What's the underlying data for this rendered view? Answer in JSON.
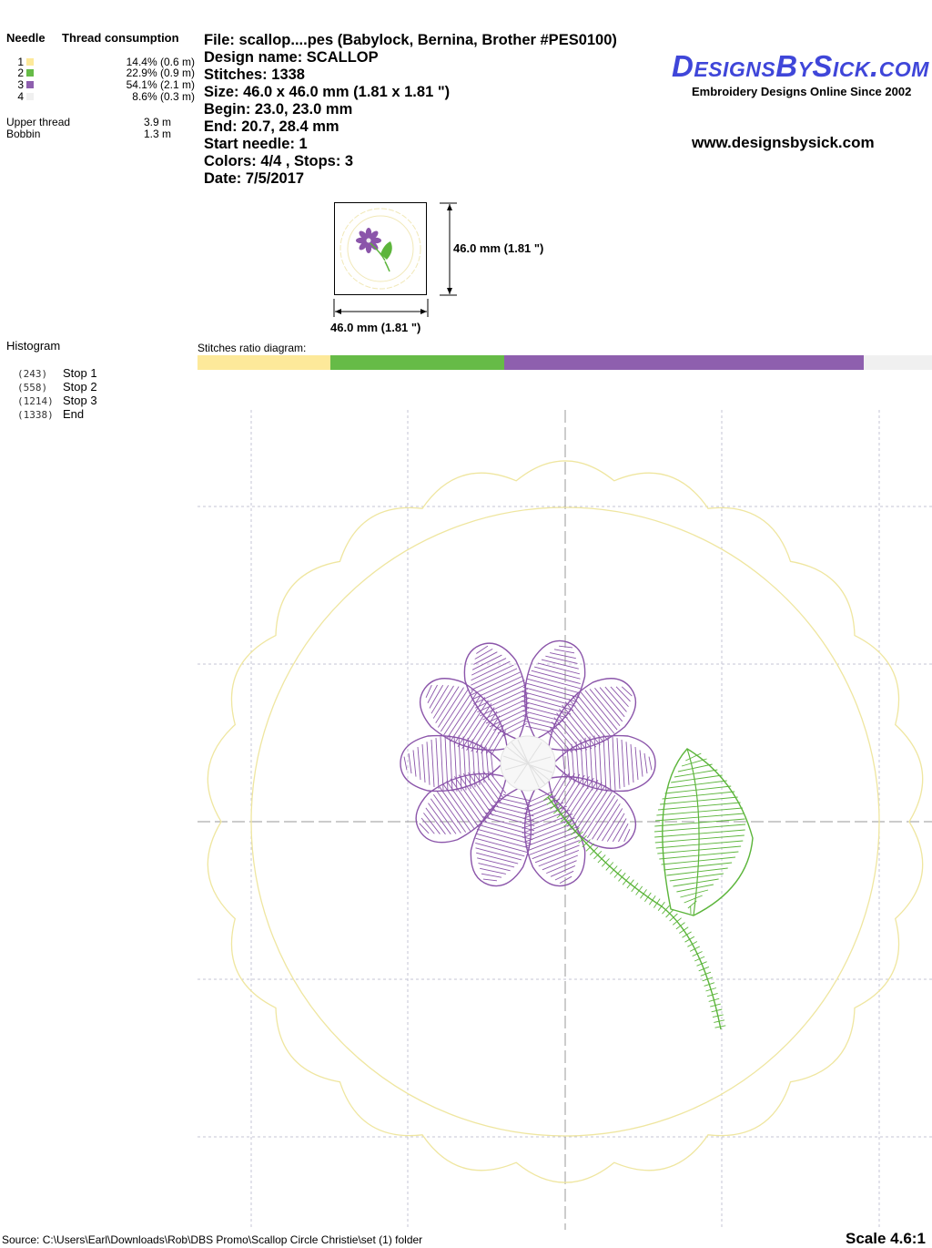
{
  "thread_table": {
    "needle_header": "Needle",
    "consumption_header": "Thread consumption",
    "needles": [
      {
        "num": "1",
        "color": "#fde99a",
        "pct": "14.4% (0.6 m)"
      },
      {
        "num": "2",
        "color": "#66bb47",
        "pct": "22.9% (0.9 m)"
      },
      {
        "num": "3",
        "color": "#8e5fae",
        "pct": "54.1% (2.1 m)"
      },
      {
        "num": "4",
        "color": "#f0f0f0",
        "pct": "8.6% (0.3 m)"
      }
    ],
    "upper_thread_label": "Upper thread",
    "upper_thread_value": "3.9 m",
    "bobbin_label": "Bobbin",
    "bobbin_value": "1.3 m"
  },
  "info": {
    "file": "File: scallop....pes  (Babylock, Bernina, Brother #PES0100)",
    "design_name": "Design name: SCALLOP",
    "stitches": "Stitches: 1338",
    "size": "Size: 46.0 x 46.0 mm (1.81 x 1.81 \")",
    "begin": "Begin: 23.0, 23.0 mm",
    "end": "End: 20.7, 28.4 mm",
    "start_needle": "Start needle: 1",
    "colors": "Colors: 4/4 , Stops: 3",
    "date": "Date: 7/5/2017"
  },
  "brand": {
    "logo": "DesignsBySick.com",
    "tagline": "Embroidery Designs Online Since 2002",
    "website": "www.designsbysick.com",
    "logo_color": "#3f46d9"
  },
  "thumbnail": {
    "height_label": "46.0 mm (1.81 \")",
    "width_label": "46.0 mm (1.81 \")"
  },
  "histogram": {
    "title": "Histogram",
    "stops": [
      {
        "count": "(243)",
        "label": "Stop 1"
      },
      {
        "count": "(558)",
        "label": "Stop 2"
      },
      {
        "count": "(1214)",
        "label": "Stop 3"
      },
      {
        "count": "(1338)",
        "label": "End"
      }
    ]
  },
  "ratio": {
    "label": "Stitches ratio diagram:",
    "segments": [
      {
        "color": "#fde99a",
        "fraction": 0.181
      },
      {
        "color": "#66bb47",
        "fraction": 0.236
      },
      {
        "color": "#8e5fae",
        "fraction": 0.49
      },
      {
        "color": "#f0f0f0",
        "fraction": 0.093
      }
    ]
  },
  "colors": {
    "yellow": "#efe6a0",
    "green": "#5cb53b",
    "purple": "#8b55aa",
    "white_thread": "#e6e6e6",
    "grid": "#c8c8d8"
  },
  "footer": {
    "source": "Source: C:\\Users\\Earl\\Downloads\\Rob\\DBS Promo\\Scallop Circle Christie\\set (1) folder",
    "scale": "Scale 4.6:1"
  }
}
